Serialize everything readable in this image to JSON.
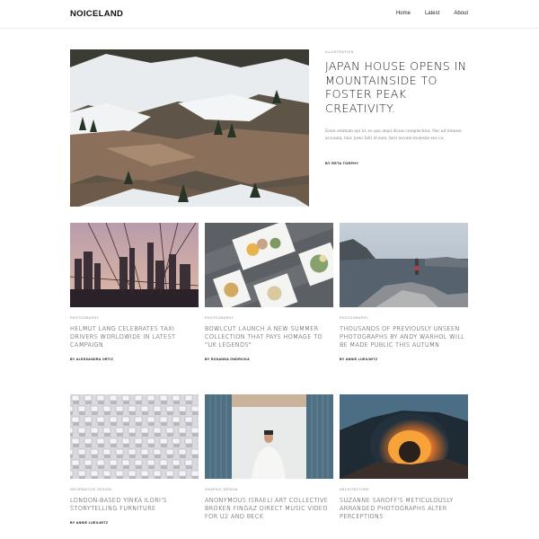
{
  "site": {
    "logo": "NOICELAND"
  },
  "nav": [
    {
      "label": "Home"
    },
    {
      "label": "Latest"
    },
    {
      "label": "About"
    }
  ],
  "hero": {
    "category": "ILLUSTRATION",
    "title": "JAPAN HOUSE OPENS IN MOUNTAINSIDE TO FOSTER PEAK CREATIVITY.",
    "excerpt": "Enim omittam qui id, ex quo atqui dictas complectitur. Nec ad timeam accusata, hinc justo falli id eum, ferri novum molestie eos cu.",
    "author": "BY RETA TORPHY"
  },
  "cards": [
    {
      "category": "PHOTOGRAPHY",
      "title": "HELMUT LANG CELEBRATES TAXI DRIVERS WORLDWIDE IN LATEST CAMPAIGN",
      "author": "BY ALESSANDRA ORTIZ"
    },
    {
      "category": "PHOTOGRAPHY",
      "title": "BOWLCUT LAUNCH A NEW SUMMER COLLECTION THAT PAYS HOMAGE TO \"UK LEGENDS\"",
      "author": "BY ROSANNA ONDRICKA"
    },
    {
      "category": "PHOTOGRAPHY",
      "title": "THOUSANDS OF PREVIOUSLY UNSEEN PHOTOGRAPHS BY ANDY WARHOL WILL BE MADE PUBLIC THIS AUTUMN",
      "author": "BY ANNIE LUEILWITZ"
    },
    {
      "category": "INFORMATIVE DESIGN",
      "title": "LONDON-BASED YINKA ILORI'S STORYTELLING FURNITURE",
      "author": "BY ANNIE LUEILWITZ"
    },
    {
      "category": "GRAPHIC DESIGN",
      "title": "ANONYMOUS ISRAELI ART COLLECTIVE BROKEN FINGAZ DIRECT MUSIC VIDEO FOR U2 AND BECK",
      "author": ""
    },
    {
      "category": "ARCHITECTURE",
      "title": "SUZANNE SAROFF'S METICULOUSLY ARRANGED PHOTOGRAPHS ALTER PERCEPTIONS",
      "author": ""
    }
  ],
  "colors": {
    "text": "#1a1a1a",
    "muted": "#8a8a8a",
    "border": "#eeeeee"
  }
}
